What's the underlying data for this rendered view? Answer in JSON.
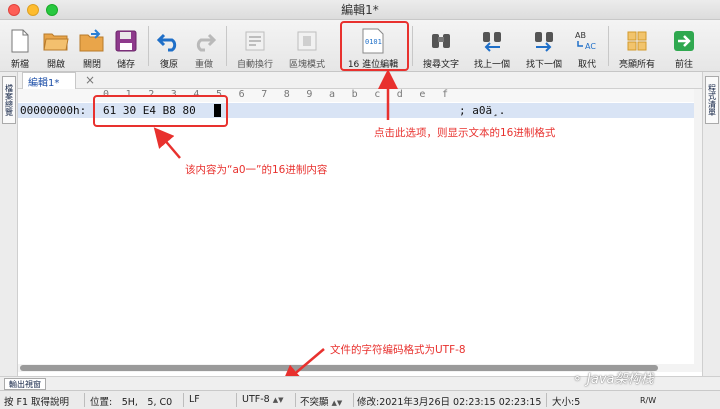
{
  "window": {
    "title": "編輯1*"
  },
  "toolbar": {
    "new": "新檔",
    "open": "開啟",
    "close": "關閉",
    "save": "儲存",
    "undo": "復原",
    "redo": "重做",
    "autowrap": "自動換行",
    "block": "區塊模式",
    "hex_label": "16 進位編輯",
    "hex_icon_text": "0101",
    "find": "搜尋文字",
    "find_prev": "找上一個",
    "find_next": "找下一個",
    "replace": "取代",
    "replace_icon_top": "AB",
    "replace_icon_bottom": "AC",
    "highlight": "亮顯所有",
    "forward": "前往"
  },
  "side": {
    "left_tab": "檔案總覽",
    "right_tab": "程式清單"
  },
  "doc": {
    "tab_label": "編輯1*",
    "close": "×"
  },
  "ruler": [
    "0",
    "1",
    "2",
    "3",
    "4",
    "5",
    "6",
    "7",
    "8",
    "9",
    "a",
    "b",
    "c",
    "d",
    "e",
    "f"
  ],
  "hex": {
    "address": "00000000h:",
    "bytes": "61 30 E4 B8 80",
    "ascii": "; a0ä¸."
  },
  "annotations": {
    "hex_note": "点击此选项，则显示文本的16进制格式",
    "content_note": "该内容为“a0一”的16进制内容",
    "encoding_note": "文件的字符编码格式为UTF-8"
  },
  "output": {
    "tab_label": "輸出視窗"
  },
  "status": {
    "help": "按 F1 取得說明",
    "position": "位置:　5H,　5, C0",
    "eol": "LF",
    "encoding": "UTF-8",
    "highlight": "不突顯",
    "modified": "修改:2021年3月26日 02:23:15 02:23:15",
    "size": "大小:5",
    "mode": "R/W"
  },
  "watermark": "Java架构栈",
  "colors": {
    "annotation": "#e8312e",
    "hex_row": "#d9e4f5",
    "tab_text": "#1d4fa8"
  }
}
